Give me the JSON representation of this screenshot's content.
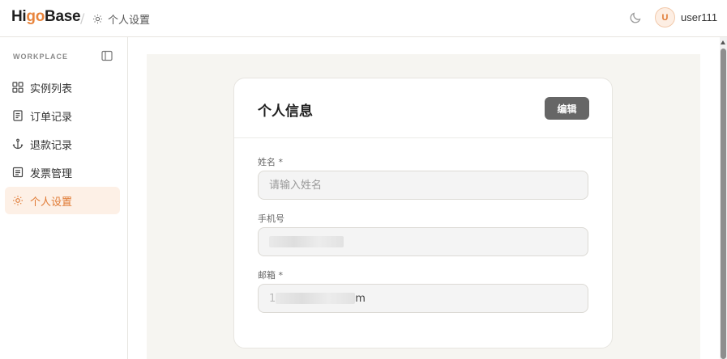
{
  "header": {
    "logo_pre": "Hi",
    "logo_accent": "go",
    "logo_post": "Base",
    "breadcrumb_separator": "/",
    "breadcrumb_current": "个人设置",
    "user_initial": "U",
    "username": "user111"
  },
  "sidebar": {
    "section_label": "WORKPLACE",
    "items": [
      {
        "label": "实例列表",
        "icon": "grid-icon"
      },
      {
        "label": "订单记录",
        "icon": "document-icon"
      },
      {
        "label": "退款记录",
        "icon": "anchor-icon"
      },
      {
        "label": "发票管理",
        "icon": "list-document-icon"
      },
      {
        "label": "个人设置",
        "icon": "settings-sun-icon",
        "active": true
      }
    ]
  },
  "card": {
    "title": "个人信息",
    "edit_label": "编辑",
    "fields": [
      {
        "label": "姓名 *",
        "placeholder": "请输入姓名",
        "value": ""
      },
      {
        "label": "手机号",
        "value_visible_suffix": ""
      },
      {
        "label": "邮箱 *",
        "value_visible_prefix": "1",
        "value_visible_suffix": "m"
      }
    ]
  },
  "colors": {
    "accent": "#e07a34",
    "active_bg": "#fdf0e6",
    "edit_button": "#666666",
    "canvas_bg": "#f6f5f1"
  }
}
